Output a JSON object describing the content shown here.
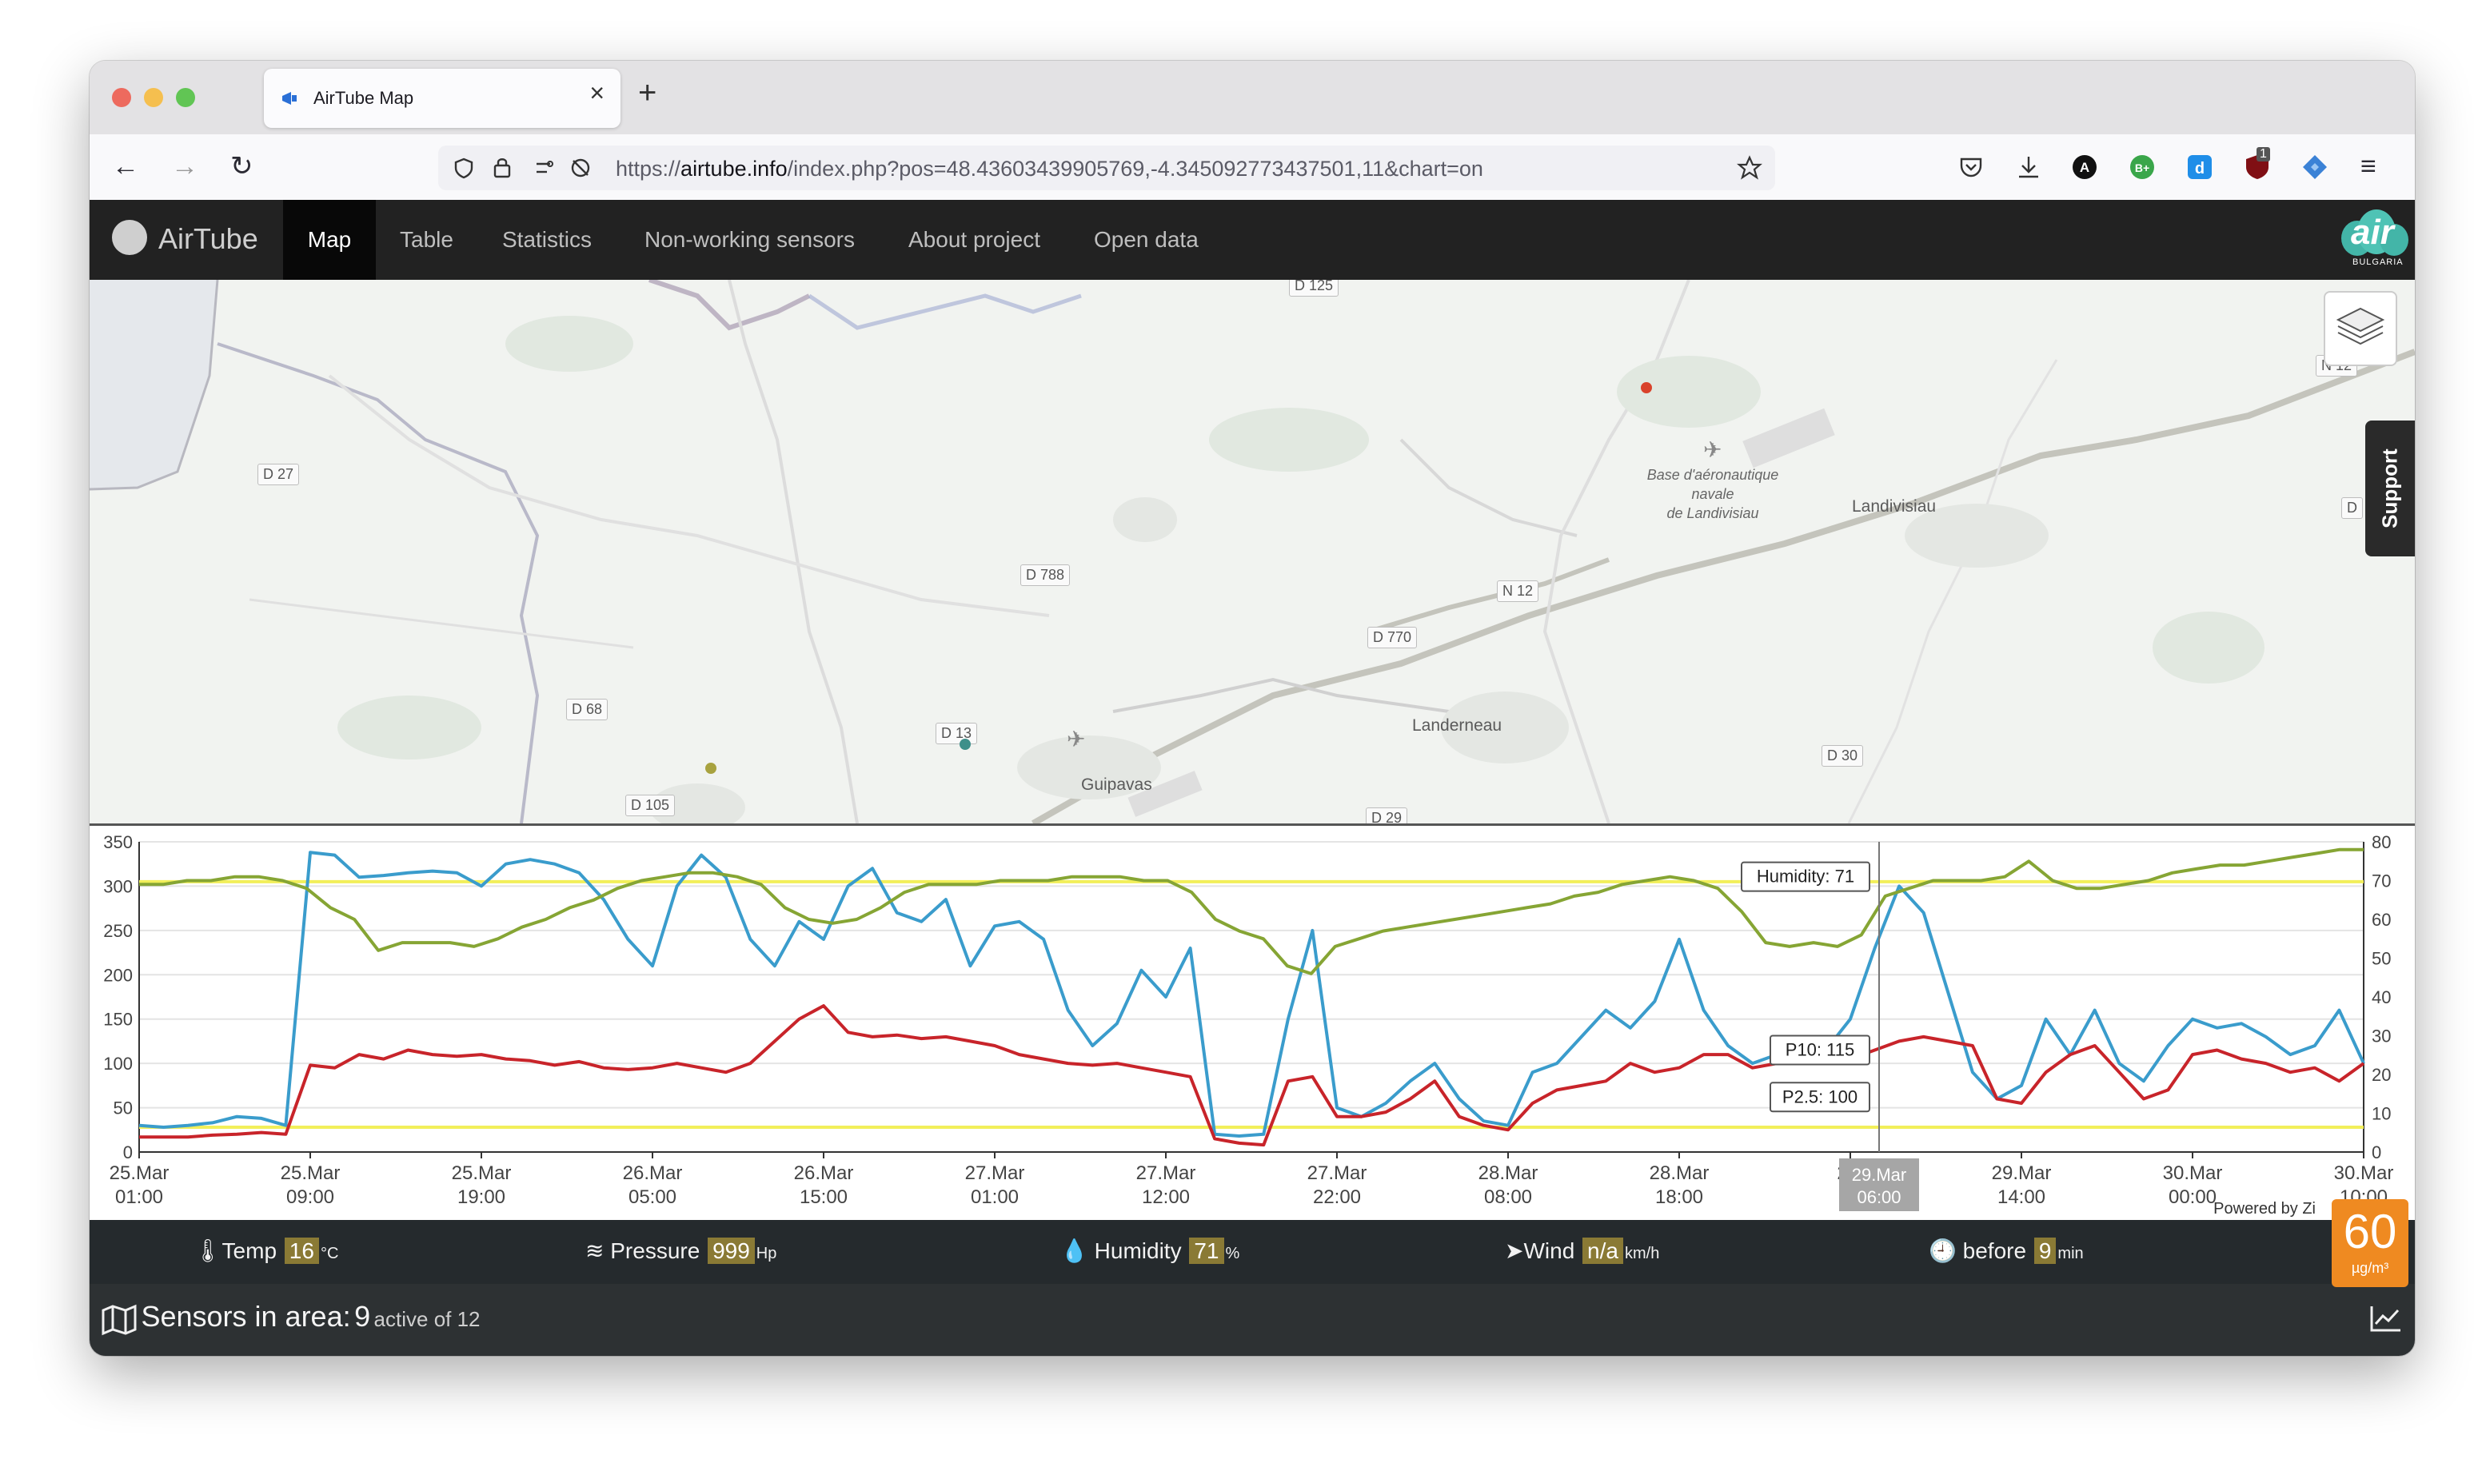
{
  "browser": {
    "tab_title": "AirTube Map",
    "url_prefix": "https://",
    "url_host": "airtube.info",
    "url_path": "/index.php?pos=48.43603439905769,-4.345092773437501,11&chart=on",
    "extension_badge": "1"
  },
  "site": {
    "brand": "AirTube",
    "menu": [
      "Map",
      "Table",
      "Statistics",
      "Non-working sensors",
      "About project",
      "Open data"
    ],
    "active_menu": "Map",
    "logo_text": "air",
    "logo_subtext": "BULGARIA",
    "support_label": "Support"
  },
  "map": {
    "places": {
      "landivisiau": "Landivisiau",
      "landerneau": "Landerneau",
      "guipavas": "Guipavas",
      "base_line1": "Base d'aéronautique",
      "base_line2": "navale",
      "base_line3": "de Landivisiau"
    },
    "roads": {
      "d125": "D 125",
      "d27": "D 27",
      "d788": "D 788",
      "n12a": "N 12",
      "n12b": "N 12",
      "d770": "D 770",
      "d68": "D 68",
      "d13": "D 13",
      "d105": "D 105",
      "d30": "D 30",
      "d29": "D 29",
      "d_right": "D"
    },
    "marker_colors": {
      "red": "#d9422b",
      "teal": "#3e8f8a",
      "olive": "#a8a23f"
    }
  },
  "chart_data": {
    "type": "line",
    "x": [
      "25.Mar 01:00",
      "25.Mar 09:00",
      "25.Mar 19:00",
      "26.Mar 05:00",
      "26.Mar 15:00",
      "27.Mar 01:00",
      "27.Mar 12:00",
      "27.Mar 22:00",
      "28.Mar 08:00",
      "28.Mar 18:00",
      "29.Mar 06:00",
      "29.Mar 14:00",
      "30.Mar 00:00",
      "30.Mar 10:00"
    ],
    "x_ticks": [
      {
        "date": "25.Mar",
        "time": "01:00"
      },
      {
        "date": "25.Mar",
        "time": "09:00"
      },
      {
        "date": "25.Mar",
        "time": "19:00"
      },
      {
        "date": "26.Mar",
        "time": "05:00"
      },
      {
        "date": "26.Mar",
        "time": "15:00"
      },
      {
        "date": "27.Mar",
        "time": "01:00"
      },
      {
        "date": "27.Mar",
        "time": "12:00"
      },
      {
        "date": "27.Mar",
        "time": "22:00"
      },
      {
        "date": "28.Mar",
        "time": "08:00"
      },
      {
        "date": "28.Mar",
        "time": "18:00"
      },
      {
        "date": "29.",
        "time": "04"
      },
      {
        "date": "29.Mar",
        "time": "14:00"
      },
      {
        "date": "30.Mar",
        "time": "00:00"
      },
      {
        "date": "30.Mar",
        "time": "10:00"
      }
    ],
    "y_left_ticks": [
      "0",
      "50",
      "100",
      "150",
      "200",
      "250",
      "300",
      "350"
    ],
    "y_right_ticks": [
      "0",
      "10",
      "20",
      "30",
      "40",
      "50",
      "60",
      "70",
      "80"
    ],
    "ylim_left": [
      0,
      350
    ],
    "ylim_right": [
      0,
      80
    ],
    "reference_lines_left": [
      28,
      305
    ],
    "series": [
      {
        "name": "P10",
        "color": "#3a9ccc",
        "axis": "left",
        "values": [
          30,
          28,
          30,
          33,
          40,
          38,
          30,
          338,
          335,
          310,
          312,
          315,
          317,
          315,
          300,
          325,
          330,
          325,
          315,
          285,
          240,
          210,
          300,
          335,
          310,
          240,
          210,
          260,
          240,
          300,
          320,
          270,
          260,
          285,
          210,
          255,
          260,
          240,
          160,
          120,
          145,
          205,
          175,
          230,
          20,
          18,
          20,
          150,
          250,
          50,
          40,
          55,
          80,
          100,
          60,
          35,
          30,
          90,
          100,
          130,
          160,
          140,
          170,
          240,
          160,
          120,
          100,
          110,
          115,
          115,
          150,
          230,
          300,
          270,
          180,
          90,
          60,
          75,
          150,
          110,
          160,
          100,
          80,
          120,
          150,
          140,
          145,
          130,
          110,
          120,
          160,
          100
        ]
      },
      {
        "name": "P2.5",
        "color": "#c8242a",
        "axis": "left",
        "values": [
          17,
          17,
          17,
          19,
          20,
          22,
          20,
          98,
          95,
          110,
          105,
          115,
          110,
          108,
          110,
          105,
          103,
          98,
          102,
          95,
          93,
          95,
          100,
          95,
          90,
          100,
          125,
          150,
          165,
          135,
          130,
          132,
          128,
          130,
          125,
          120,
          110,
          105,
          100,
          98,
          100,
          95,
          90,
          85,
          15,
          10,
          8,
          80,
          85,
          40,
          40,
          45,
          60,
          80,
          40,
          30,
          25,
          55,
          70,
          75,
          80,
          100,
          90,
          95,
          110,
          110,
          95,
          100,
          100,
          100,
          105,
          115,
          125,
          130,
          125,
          120,
          60,
          55,
          90,
          110,
          120,
          90,
          60,
          70,
          110,
          115,
          105,
          100,
          90,
          95,
          80,
          100
        ]
      },
      {
        "name": "Humidity",
        "color": "#86a534",
        "axis": "right",
        "values": [
          69,
          69,
          70,
          70,
          71,
          71,
          70,
          68,
          63,
          60,
          52,
          54,
          54,
          54,
          53,
          55,
          58,
          60,
          63,
          65,
          68,
          70,
          71,
          72,
          72,
          71,
          69,
          63,
          60,
          59,
          60,
          63,
          67,
          69,
          69,
          69,
          70,
          70,
          70,
          71,
          71,
          71,
          70,
          70,
          67,
          60,
          57,
          55,
          48,
          46,
          53,
          55,
          57,
          58,
          59,
          60,
          61,
          62,
          63,
          64,
          66,
          67,
          69,
          70,
          71,
          70,
          68,
          62,
          54,
          53,
          54,
          53,
          56,
          66,
          68,
          70,
          70,
          70,
          71,
          75,
          70,
          68,
          68,
          69,
          70,
          72,
          73,
          74,
          74,
          75,
          76,
          77,
          78,
          78
        ]
      }
    ],
    "tooltips": {
      "humidity": "Humidity: 71",
      "p10": "P10: 115",
      "p25": "P2.5: 100"
    },
    "crosshair_label": {
      "date": "29.Mar",
      "time": "06:00"
    },
    "credit": "Powered by Zi"
  },
  "footer": {
    "temp_label": "Temp",
    "temp_value": "16",
    "temp_unit": "°C",
    "pressure_label": "Pressure",
    "pressure_value": "999",
    "pressure_unit": "Hp",
    "humidity_label": "Humidity",
    "humidity_value": "71",
    "humidity_unit": "%",
    "wind_label": "Wind",
    "wind_value": "n/a",
    "wind_unit": "km/h",
    "before_label": "before",
    "before_value": "9",
    "before_unit": "min",
    "area_label": "Sensors in area:",
    "area_count": "9",
    "area_sub": "active of 12",
    "aqi_value": "60",
    "aqi_unit": "µg/m³"
  }
}
